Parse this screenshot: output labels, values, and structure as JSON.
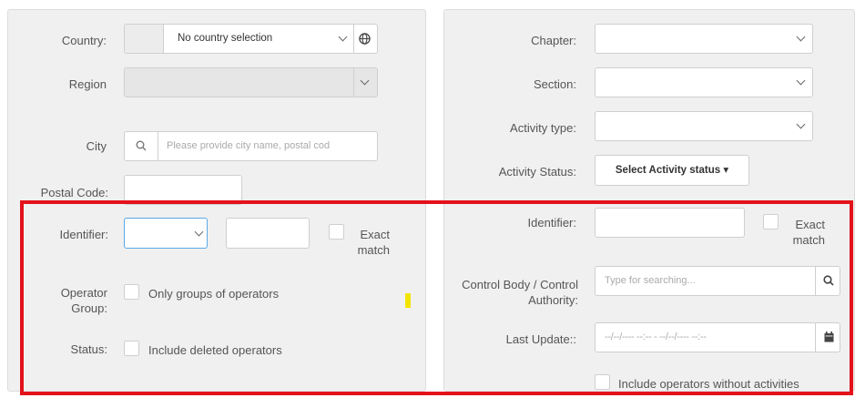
{
  "left": {
    "country": {
      "label": "Country:",
      "value": "No country selection"
    },
    "region": {
      "label": "Region"
    },
    "city": {
      "label": "City",
      "placeholder": "Please provide city name, postal cod"
    },
    "postal_code": {
      "label": "Postal Code:"
    },
    "identifier": {
      "label": "Identifier:",
      "exact_match": "Exact match"
    },
    "operator_group": {
      "label": "Operator Group:",
      "checkbox_label": "Only groups of operators"
    },
    "status": {
      "label": "Status:",
      "checkbox_label": "Include deleted operators"
    }
  },
  "right": {
    "chapter": {
      "label": "Chapter:"
    },
    "section": {
      "label": "Section:"
    },
    "activity_type": {
      "label": "Activity type:"
    },
    "activity_status": {
      "label": "Activity Status:",
      "button": "Select Activity status ▾"
    },
    "identifier": {
      "label": "Identifier:",
      "exact_match": "Exact match"
    },
    "control_body": {
      "label": "Control Body / Control Authority:",
      "placeholder": "Type for searching..."
    },
    "last_update": {
      "label": "Last Update::",
      "placeholder": "--/--/---- --:-- - --/--/---- --:--"
    },
    "include_without_activities": {
      "checkbox_label": "Include operators without activities"
    }
  },
  "icons": {
    "globe": "globe-icon",
    "search": "search-icon",
    "calendar": "calendar-icon",
    "chevron": "chevron-down-icon"
  },
  "colors": {
    "highlight_frame": "#e3121b",
    "marker": "#f2e400",
    "panel_bg": "#f0f0f0"
  }
}
